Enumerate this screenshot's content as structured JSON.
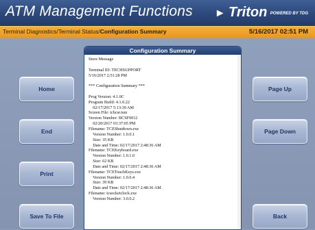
{
  "header": {
    "title": "ATM Management Functions",
    "logo": {
      "icon": "triton-logo-icon",
      "name": "Triton",
      "tagline": "POWERED BY TDG"
    }
  },
  "statusbar": {
    "breadcrumb_path": "Terminal Diagnostics/Terminal Status/",
    "breadcrumb_current": "Configuration Summary",
    "datetime": "5/16/2017  02:51 PM"
  },
  "buttons": {
    "home": "Home",
    "end": "End",
    "print": "Print",
    "save_to_file": "Save To File",
    "page_up": "Page Up",
    "page_down": "Page Down",
    "back": "Back"
  },
  "panel": {
    "title": "Configuration Summary",
    "lines": [
      "Store Message",
      "",
      "Terminal ID: TECHSUPPORT",
      "5/16/2017 2:51:28 PM",
      "",
      "*** Configuration Summary ***",
      "",
      "Prog Version: 4.1.0C",
      "Program Build: 4.1.0.22",
      "    02/17/2017 5:13:30 AM",
      "Screen File: tcbcsr.tsm",
      "Version Number: BCSF0012",
      "    02/20/2017 03:37:05 PM",
      "Filename: TCEShutdown.exe",
      "    Version Number: 1.0.0.1",
      "    Size: 35 KB",
      "    Date and Time: 02/17/2017 2:48:36 AM",
      "Filename: TCEKeyboard.exe",
      "    Version Number: 1.0.1.0",
      "    Size: 62 KB",
      "    Date and Time: 02/17/2017 2:48:36 AM",
      "Filename: TCETouchKeys.exe",
      "    Version Number: 1.0.0.4",
      "    Size: 39 KB",
      "    Date and Time: 02/17/2017 2:48:36 AM",
      "Filename: tcsocketclock.exe",
      "    Version Number: 3.0.0.2"
    ]
  }
}
